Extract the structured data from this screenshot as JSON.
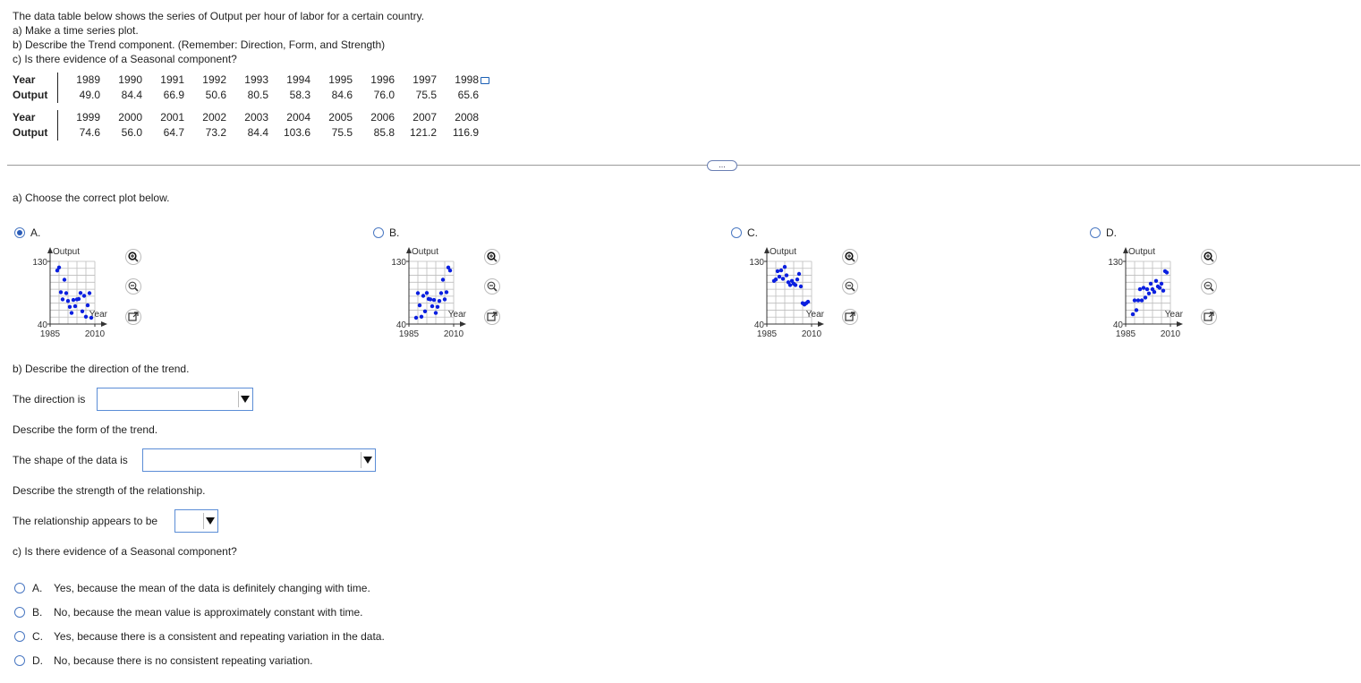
{
  "intro": {
    "line1": "The data table below shows the series of Output per hour of labor for a certain country.",
    "line2": "a) Make a time series plot.",
    "line3": "b) Describe the Trend component. (Remember: Direction, Form, and Strength)",
    "line4": "c) Is there evidence of a Seasonal component?"
  },
  "table": {
    "year_label": "Year",
    "output_label": "Output",
    "row1_years": [
      "1989",
      "1990",
      "1991",
      "1992",
      "1993",
      "1994",
      "1995",
      "1996",
      "1997",
      "1998"
    ],
    "row1_outputs": [
      "49.0",
      "84.4",
      "66.9",
      "50.6",
      "80.5",
      "58.3",
      "84.6",
      "76.0",
      "75.5",
      "65.6"
    ],
    "row2_years": [
      "1999",
      "2000",
      "2001",
      "2002",
      "2003",
      "2004",
      "2005",
      "2006",
      "2007",
      "2008"
    ],
    "row2_outputs": [
      "74.6",
      "56.0",
      "64.7",
      "73.2",
      "84.4",
      "103.6",
      "75.5",
      "85.8",
      "121.2",
      "116.9"
    ]
  },
  "more_button": "...",
  "part_a": {
    "prompt": "a) Choose the correct plot below.",
    "options": [
      {
        "letter": "A.",
        "selected": true
      },
      {
        "letter": "B.",
        "selected": false
      },
      {
        "letter": "C.",
        "selected": false
      },
      {
        "letter": "D.",
        "selected": false
      }
    ],
    "plot_labels": {
      "y_axis": "Output",
      "x_axis": "Year",
      "y_top": "130",
      "y_bottom": "40",
      "x_left": "1985",
      "x_right": "2010"
    }
  },
  "part_b": {
    "direction_prompt": "b) Describe the direction of the trend.",
    "direction_label": "The direction is",
    "form_prompt": "Describe the form of the trend.",
    "form_label": "The shape of the data is",
    "strength_prompt": "Describe the strength of the relationship.",
    "strength_label": "The relationship appears to be"
  },
  "part_c": {
    "prompt": "c) Is there evidence of a Seasonal component?",
    "answers": [
      {
        "letter": "A.",
        "text": "Yes, because the mean of the data is definitely changing with time."
      },
      {
        "letter": "B.",
        "text": "No, because the mean value is approximately constant with time."
      },
      {
        "letter": "C.",
        "text": "Yes, because there is a consistent and repeating variation in the data."
      },
      {
        "letter": "D.",
        "text": "No, because there is no consistent repeating variation."
      }
    ]
  },
  "chart_data": [
    {
      "type": "scatter",
      "panel": "A",
      "xlim": [
        1985,
        2010
      ],
      "ylim": [
        40,
        130
      ],
      "xlabel": "Year",
      "ylabel": "Output",
      "x": [
        1989,
        1990,
        1991,
        1992,
        1993,
        1994,
        1995,
        1996,
        1997,
        1998,
        1999,
        2000,
        2001,
        2002,
        2003,
        2004,
        2005,
        2006,
        2007,
        2008
      ],
      "y": [
        116.9,
        121.2,
        85.8,
        75.5,
        103.6,
        84.4,
        73.2,
        64.7,
        56.0,
        74.6,
        65.6,
        75.5,
        76.0,
        84.6,
        58.3,
        80.5,
        50.6,
        66.9,
        84.4,
        49.0
      ]
    },
    {
      "type": "scatter",
      "panel": "B",
      "xlim": [
        1985,
        2010
      ],
      "ylim": [
        40,
        130
      ],
      "xlabel": "Year",
      "ylabel": "Output",
      "x": [
        1989,
        1990,
        1991,
        1992,
        1993,
        1994,
        1995,
        1996,
        1997,
        1998,
        1999,
        2000,
        2001,
        2002,
        2003,
        2004,
        2005,
        2006,
        2007,
        2008
      ],
      "y": [
        49.0,
        84.4,
        66.9,
        50.6,
        80.5,
        58.3,
        84.6,
        76.0,
        75.5,
        65.6,
        74.6,
        56.0,
        64.7,
        73.2,
        84.4,
        103.6,
        75.5,
        85.8,
        121.2,
        116.9
      ]
    },
    {
      "type": "scatter",
      "panel": "C",
      "xlim": [
        1985,
        2010
      ],
      "ylim": [
        40,
        130
      ],
      "xlabel": "Year",
      "ylabel": "Output",
      "x": [
        1989,
        1990,
        1991,
        1992,
        1993,
        1994,
        1995,
        1996,
        1997,
        1998,
        1999,
        2000,
        2001,
        2002,
        2003,
        2004,
        2005,
        2006,
        2007,
        2008
      ],
      "y": [
        102,
        104,
        116,
        108,
        117,
        105,
        122,
        110,
        100,
        96,
        102,
        98,
        96,
        104,
        112,
        94,
        70,
        68,
        70,
        72
      ]
    },
    {
      "type": "scatter",
      "panel": "D",
      "xlim": [
        1985,
        2010
      ],
      "ylim": [
        40,
        130
      ],
      "xlabel": "Year",
      "ylabel": "Output",
      "x": [
        1989,
        1990,
        1991,
        1992,
        1993,
        1994,
        1995,
        1996,
        1997,
        1998,
        1999,
        2000,
        2001,
        2002,
        2003,
        2004,
        2005,
        2006,
        2007,
        2008
      ],
      "y": [
        54,
        74,
        60,
        74,
        90,
        74,
        92,
        78,
        90,
        84,
        98,
        90,
        86,
        102,
        94,
        92,
        98,
        88,
        116,
        114
      ]
    }
  ]
}
